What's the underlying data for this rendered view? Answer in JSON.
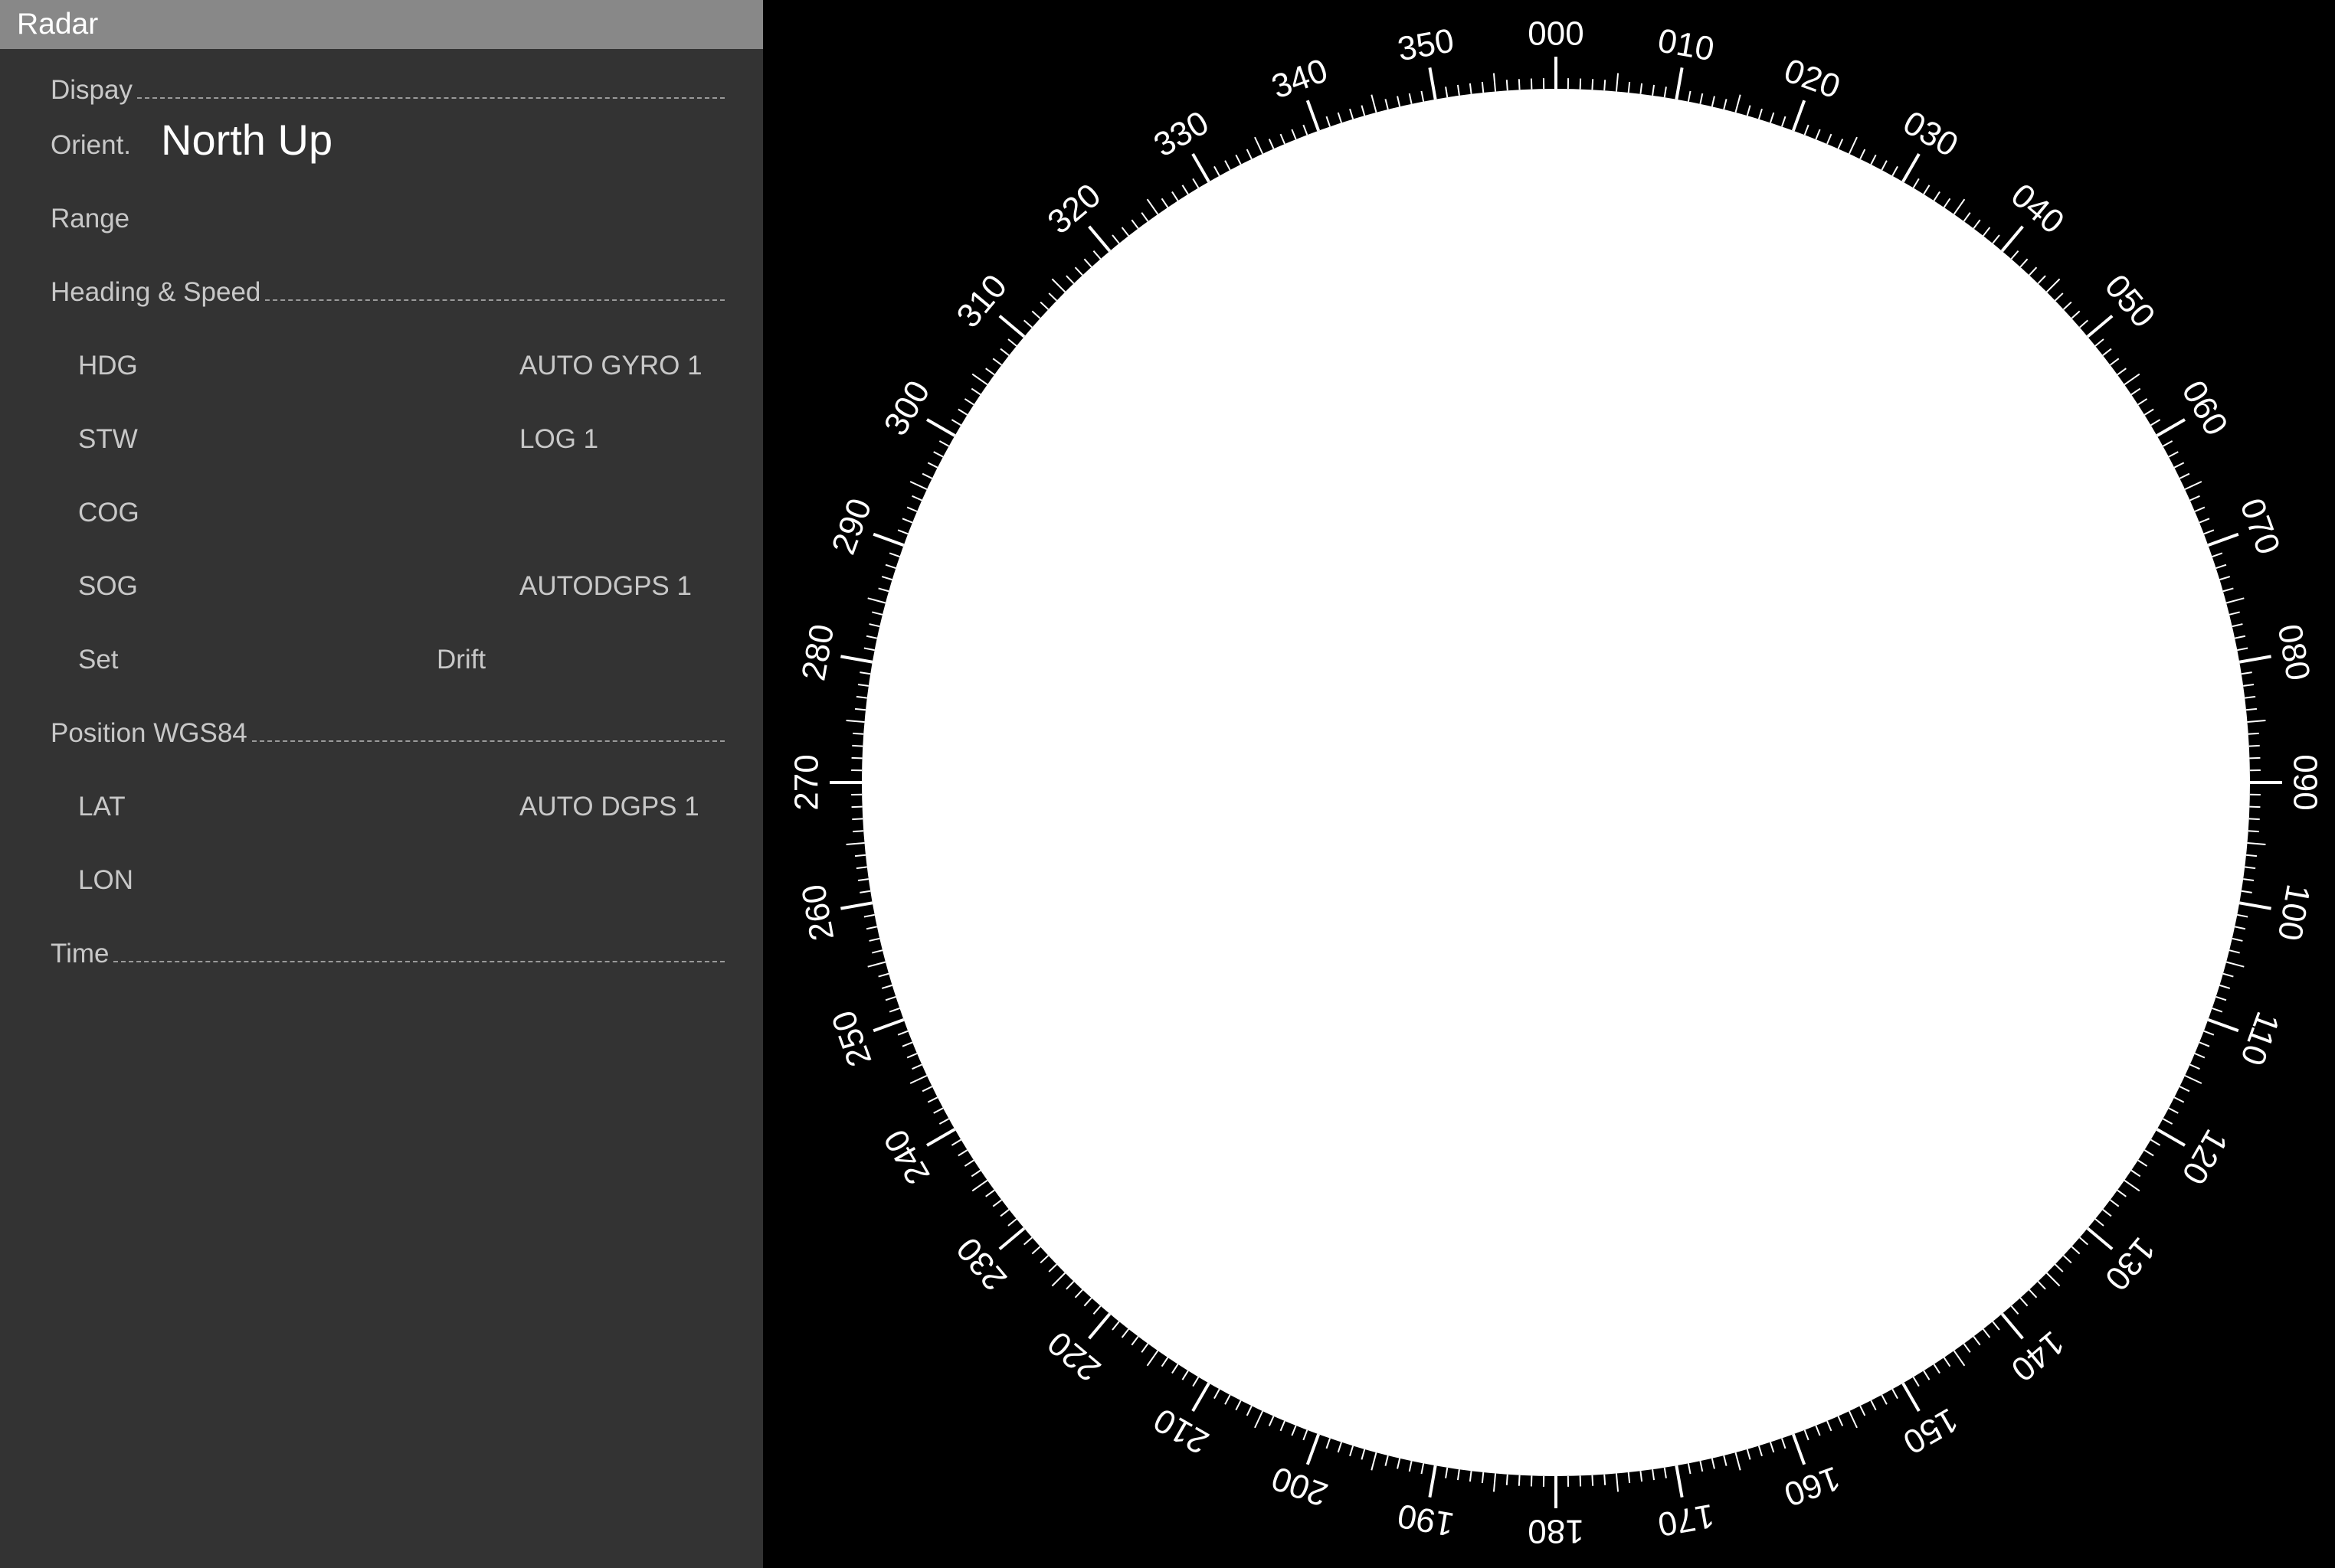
{
  "window": {
    "title": "Radar"
  },
  "panel": {
    "display_section": "Dispay",
    "orient_label": "Orient.",
    "orient_value": "North Up",
    "range_label": "Range",
    "heading_speed_section": "Heading & Speed",
    "hdg_label": "HDG",
    "hdg_source": "AUTO GYRO 1",
    "stw_label": "STW",
    "stw_source": "LOG 1",
    "cog_label": "COG",
    "sog_label": "SOG",
    "sog_source": "AUTODGPS 1",
    "set_label": "Set",
    "drift_label": "Drift",
    "position_section": "Position WGS84",
    "lat_label": "LAT",
    "lat_source": "AUTO DGPS 1",
    "lon_label": "LON",
    "time_section": "Time"
  },
  "compass": {
    "bearing_labels": [
      "000",
      "010",
      "020",
      "030",
      "040",
      "050",
      "060",
      "070",
      "080",
      "090",
      "100",
      "110",
      "120",
      "130",
      "140",
      "150",
      "160",
      "170",
      "180",
      "190",
      "200",
      "210",
      "220",
      "230",
      "240",
      "250",
      "260",
      "270",
      "280",
      "290",
      "300",
      "310",
      "320",
      "330",
      "340",
      "350"
    ],
    "scope_color": "#ffffff",
    "background_color": "#000000",
    "tick_color": "#ffffff"
  },
  "colors": {
    "panel_bg": "#333333",
    "titlebar_bg": "#888888",
    "label_text": "#c8c8c8",
    "value_text": "#ffffff"
  }
}
